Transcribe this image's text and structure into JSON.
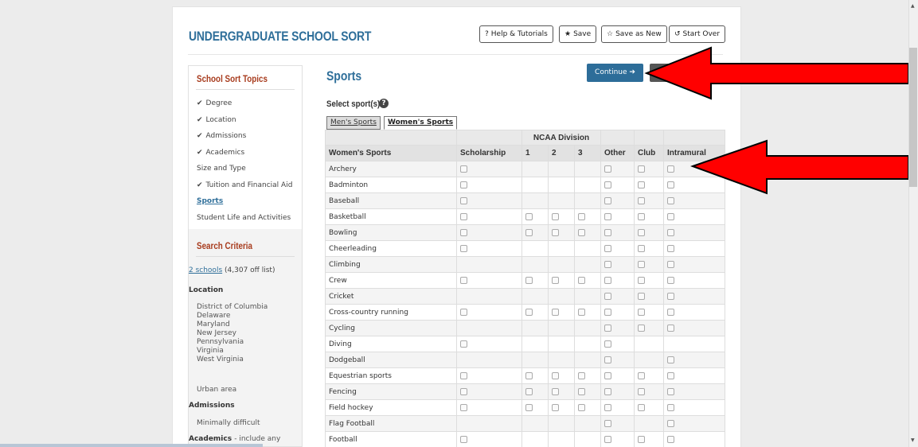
{
  "app": {
    "title": "UNDERGRADUATE SCHOOL SORT"
  },
  "toolbar": {
    "help": {
      "icon": "question-icon",
      "glyph": "?",
      "label": "Help & Tutorials"
    },
    "save": {
      "icon": "star-filled-icon",
      "glyph": "★",
      "label": "Save"
    },
    "save_as_new": {
      "icon": "star-outline-icon",
      "glyph": "☆",
      "label": "Save as New"
    },
    "start_over": {
      "icon": "undo-icon",
      "glyph": "↺",
      "label": "Start Over"
    }
  },
  "sidebar": {
    "topics_heading": "School Sort Topics",
    "check_glyph": "✔",
    "topics": [
      {
        "label": "Degree",
        "checked": true
      },
      {
        "label": "Location",
        "checked": true
      },
      {
        "label": "Admissions",
        "checked": true
      },
      {
        "label": "Academics",
        "checked": true
      },
      {
        "label": "Size and Type",
        "checked": false
      },
      {
        "label": "Tuition and Financial Aid",
        "checked": true
      },
      {
        "label": "Sports",
        "checked": false,
        "active": true
      },
      {
        "label": "Student Life and Activities",
        "checked": false
      }
    ],
    "criteria_heading": "Search Criteria",
    "schools_link": "2 schools",
    "schools_note": "(4,307 off list)",
    "location_heading": "Location",
    "locations": [
      "District of Columbia",
      "Delaware",
      "Maryland",
      "New Jersey",
      "Pennsylvania",
      "Virginia",
      "West Virginia"
    ],
    "urban": "Urban area",
    "admissions_heading": "Admissions",
    "admissions_value": "Minimally difficult",
    "academics_heading": "Academics",
    "academics_suffix": "- include any"
  },
  "main": {
    "heading": "Sports",
    "continue_label": "Continue",
    "continue_glyph": "➔",
    "select_label": "Select sport(s)",
    "help_glyph": "?",
    "tabs": {
      "men": "Men's Sports",
      "women": "Women's Sports"
    },
    "group_header": "NCAA Division",
    "columns": [
      "Women's Sports",
      "Scholarship",
      "1",
      "2",
      "3",
      "Other",
      "Club",
      "Intramural"
    ],
    "rows": [
      {
        "name": "Archery",
        "cb": [
          1,
          0,
          0,
          0,
          1,
          1,
          1
        ]
      },
      {
        "name": "Badminton",
        "cb": [
          1,
          0,
          0,
          0,
          1,
          1,
          1
        ]
      },
      {
        "name": "Baseball",
        "cb": [
          1,
          0,
          0,
          0,
          1,
          1,
          1
        ]
      },
      {
        "name": "Basketball",
        "cb": [
          1,
          1,
          1,
          1,
          1,
          1,
          1
        ]
      },
      {
        "name": "Bowling",
        "cb": [
          1,
          1,
          1,
          1,
          1,
          1,
          1
        ]
      },
      {
        "name": "Cheerleading",
        "cb": [
          1,
          0,
          0,
          0,
          1,
          1,
          1
        ]
      },
      {
        "name": "Climbing",
        "cb": [
          0,
          0,
          0,
          0,
          1,
          1,
          1
        ]
      },
      {
        "name": "Crew",
        "cb": [
          1,
          1,
          1,
          1,
          1,
          1,
          1
        ]
      },
      {
        "name": "Cricket",
        "cb": [
          0,
          0,
          0,
          0,
          1,
          1,
          1
        ]
      },
      {
        "name": "Cross-country running",
        "cb": [
          1,
          1,
          1,
          1,
          1,
          1,
          1
        ]
      },
      {
        "name": "Cycling",
        "cb": [
          0,
          0,
          0,
          0,
          1,
          1,
          1
        ]
      },
      {
        "name": "Diving",
        "cb": [
          1,
          0,
          0,
          0,
          1,
          0,
          0
        ]
      },
      {
        "name": "Dodgeball",
        "cb": [
          0,
          0,
          0,
          0,
          1,
          0,
          1
        ]
      },
      {
        "name": "Equestrian sports",
        "cb": [
          1,
          1,
          1,
          1,
          1,
          1,
          1
        ]
      },
      {
        "name": "Fencing",
        "cb": [
          1,
          1,
          1,
          1,
          1,
          1,
          1
        ]
      },
      {
        "name": "Field hockey",
        "cb": [
          1,
          1,
          1,
          1,
          1,
          1,
          1
        ]
      },
      {
        "name": "Flag Football",
        "cb": [
          0,
          0,
          0,
          0,
          1,
          0,
          1
        ]
      },
      {
        "name": "Football",
        "cb": [
          1,
          0,
          0,
          0,
          1,
          1,
          1
        ]
      }
    ]
  },
  "annotations": {
    "arrow_color": "#ff0000"
  },
  "colors": {
    "brand": "#2f6f9a",
    "topic_heading": "#a83c1e",
    "continue_bg": "#2d6d99"
  }
}
